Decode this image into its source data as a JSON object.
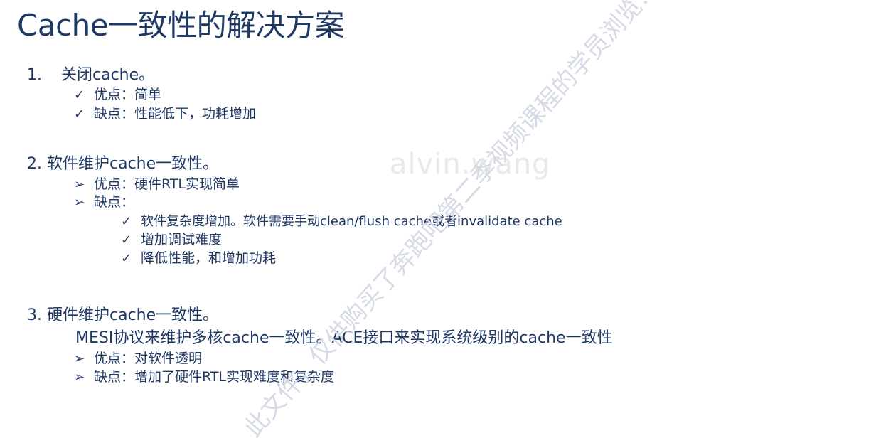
{
  "title": "Cache一致性的解决方案",
  "sections": [
    {
      "number": "1.",
      "heading": "关闭cache。",
      "bullets": [
        {
          "mark": "✓",
          "text": "优点：简单"
        },
        {
          "mark": "✓",
          "text": "缺点：性能低下，功耗增加"
        }
      ]
    },
    {
      "heading": "2. 软件维护cache一致性。",
      "bullets": [
        {
          "mark": "➢",
          "text": "优点：硬件RTL实现简单"
        },
        {
          "mark": "➢",
          "text": "缺点："
        }
      ],
      "sub_bullets": [
        {
          "mark": "✓",
          "text": "软件复杂度增加。软件需要手动clean/flush cache或者invalidate cache"
        },
        {
          "mark": "✓",
          "text": "增加调试难度"
        },
        {
          "mark": "✓",
          "text": "降低性能，和增加功耗"
        }
      ]
    },
    {
      "heading": "3. 硬件维护cache一致性。",
      "description": "MESI协议来维护多核cache一致性。ACE接口来实现系统级别的cache一致性",
      "bullets": [
        {
          "mark": "➢",
          "text": "优点：对软件透明"
        },
        {
          "mark": "➢",
          "text": "缺点：增加了硬件RTL实现难度和复杂度"
        }
      ]
    }
  ],
  "watermarks": {
    "name": "alvin.wang",
    "diagonal": "此文件，仅供购买了奔跑吧第二季视频课程的学员浏览!"
  }
}
